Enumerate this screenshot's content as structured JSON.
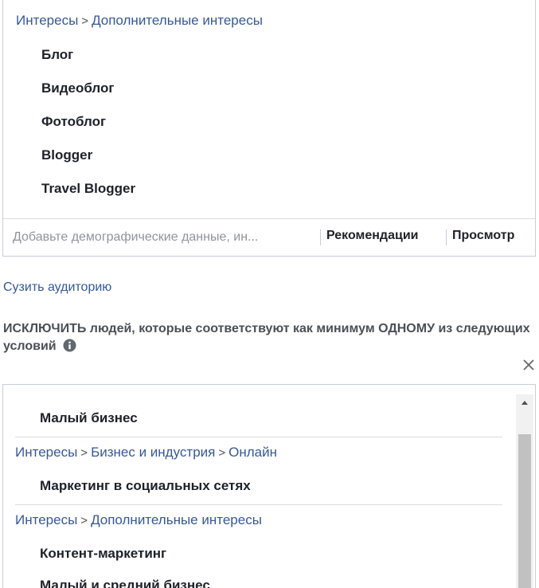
{
  "include": {
    "path": {
      "parts": [
        "Интересы",
        "Дополнительные интересы"
      ],
      "separator": ">"
    },
    "items": [
      "Блог",
      "Видеоблог",
      "Фотоблог",
      "Blogger",
      "Travel Blogger"
    ],
    "search": {
      "placeholder": "Добавьте демографические данные, ин...",
      "value": ""
    },
    "recommendations_label": "Рекомендации",
    "browse_label": "Просмотр"
  },
  "narrow_label": "Сузить аудиторию",
  "exclude": {
    "heading": "ИСКЛЮЧИТЬ людей, которые соответствуют как минимум ОДНОМУ из следующих условий",
    "info_icon": "info-icon",
    "close_icon": "close-icon",
    "rows": [
      {
        "type": "item",
        "label": "Малый бизнес"
      },
      {
        "type": "path",
        "parts": [
          "Интересы",
          "Бизнес и индустрия",
          "Онлайн"
        ]
      },
      {
        "type": "item",
        "label": "Маркетинг в социальных сетях"
      },
      {
        "type": "path",
        "parts": [
          "Интересы",
          "Дополнительные интересы"
        ]
      },
      {
        "type": "item",
        "label": "Контент-маркетинг"
      },
      {
        "type": "item",
        "label": "Малый и средний бизнес"
      }
    ],
    "separator": ">"
  },
  "colors": {
    "link": "#365899",
    "text": "#1d2129",
    "muted": "#90949c",
    "border": "#c8ccd5"
  }
}
